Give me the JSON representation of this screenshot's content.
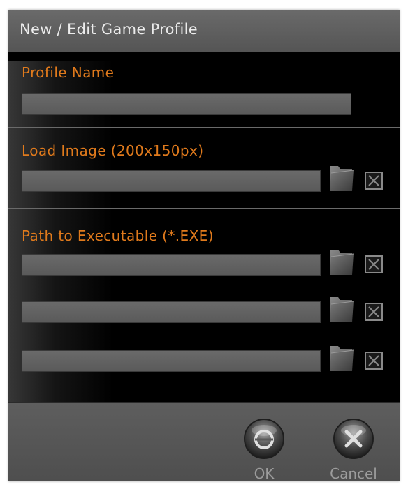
{
  "dialog": {
    "title": "New / Edit Game Profile"
  },
  "sections": {
    "profile_name": {
      "label": "Profile Name",
      "value": ""
    },
    "load_image": {
      "label": "Load Image (200x150px)",
      "value": ""
    },
    "executable": {
      "label": "Path to Executable (*.EXE)",
      "paths": [
        "",
        "",
        ""
      ]
    }
  },
  "buttons": {
    "ok_label": "OK",
    "cancel_label": "Cancel"
  },
  "colors": {
    "accent": "#e07a1c",
    "background": "#000000",
    "field": "#5f5f5f",
    "title_bar": "#5e5e5e"
  },
  "icons": {
    "browse": "folder-icon",
    "clear": "close-box-icon",
    "ok": "circle-icon",
    "cancel": "x-icon"
  }
}
